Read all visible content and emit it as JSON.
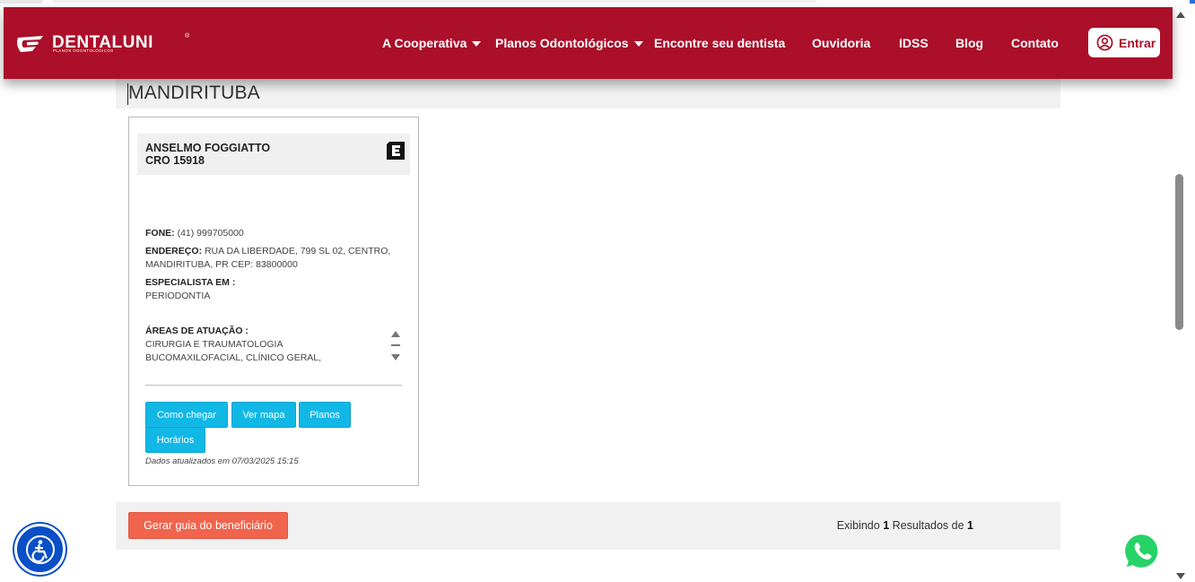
{
  "header": {
    "logo_text": "DENTALUNI",
    "logo_subtext": "PLANOS ODONTOLÓGICOS",
    "nav": [
      {
        "label": "A Cooperativa",
        "has_dropdown": true
      },
      {
        "label": "Planos Odontológicos",
        "has_dropdown": true
      },
      {
        "label": "Encontre seu dentista",
        "has_dropdown": false
      },
      {
        "label": "Ouvidoria",
        "has_dropdown": false
      },
      {
        "label": "IDSS",
        "has_dropdown": false
      },
      {
        "label": "Blog",
        "has_dropdown": false
      },
      {
        "label": "Contato",
        "has_dropdown": false
      }
    ],
    "login_label": "Entrar",
    "brand_color": "#ab0f2a"
  },
  "city": {
    "title": "MANDIRITUBA"
  },
  "dentist": {
    "name": "ANSELMO FOGGIATTO",
    "cro": "CRO 15918",
    "badge_icon": "specialist-e-icon",
    "phone_label": "FONE:",
    "phone": "(41) 999705000",
    "address_label": "ENDEREÇO:",
    "address_line1": "RUA DA LIBERDADE, 799 SL 02, CENTRO,",
    "address_line2": "MANDIRITUBA, PR CEP: 83800000",
    "specialist_label": "ESPECIALISTA EM :",
    "specialist": "PERIODONTIA",
    "areas_label": "ÁREAS DE ATUAÇÃO :",
    "areas_line1": "CIRURGIA E TRAUMATOLOGIA",
    "areas_line2": "BUCOMAXILOFACIAL, CLÍNICO GERAL,",
    "buttons": {
      "directions": "Como chegar",
      "map": "Ver mapa",
      "plans": "Planos",
      "hours": "Horários"
    },
    "updated": "Dados atualizados em 07/03/2025 15:15"
  },
  "footer": {
    "guide_button": "Gerar guia do beneficiário",
    "results_prefix": "Exibindo",
    "results_shown": "1",
    "results_middle": "Resultados de",
    "results_total": "1"
  },
  "floating": {
    "accessibility_icon": "accessibility-icon",
    "whatsapp_icon": "whatsapp-icon"
  },
  "colors": {
    "action_blue": "#11b8e6",
    "guide_red": "#f0644e",
    "accessibility_blue": "#0a4fc7",
    "whatsapp_green": "#25d366"
  }
}
